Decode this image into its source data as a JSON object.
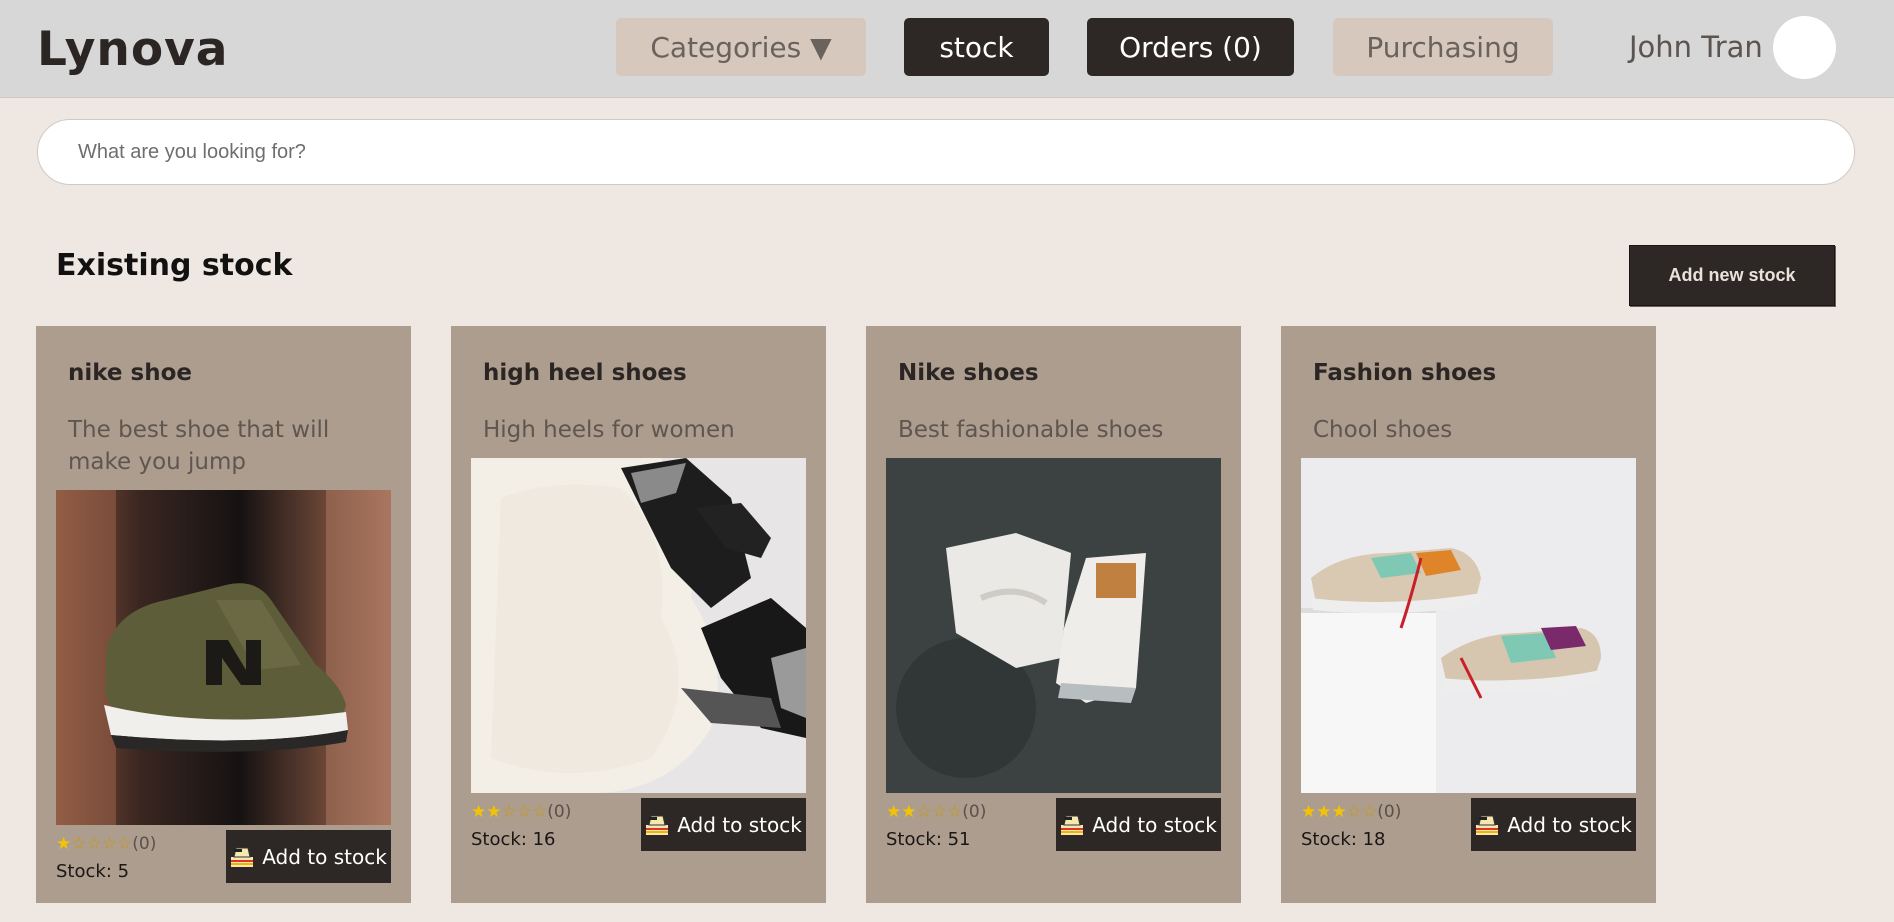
{
  "header": {
    "logo": "Lynova",
    "nav": {
      "categories": "Categories ▼",
      "stock": "stock",
      "orders": "Orders (0)",
      "purchasing": "Purchasing"
    },
    "user_name": "John Tran"
  },
  "search": {
    "placeholder": "What are you looking for?",
    "value": ""
  },
  "section": {
    "title": "Existing stock",
    "add_new_label": "Add new stock"
  },
  "products": [
    {
      "title": "nike shoe",
      "description": "The best shoe that will make you jump",
      "rating_stars": 1,
      "rating_max": 5,
      "rating_count": "(0)",
      "stock": "Stock: 5",
      "button": "Add to stock",
      "image": "green-sneaker-photo"
    },
    {
      "title": "high heel shoes",
      "description": "High heels for women",
      "rating_stars": 2,
      "rating_max": 5,
      "rating_count": "(0)",
      "stock": "Stock: 16",
      "button": "Add to stock",
      "image": "black-heels-on-fur-photo"
    },
    {
      "title": "Nike shoes",
      "description": "Best fashionable shoes",
      "rating_stars": 2,
      "rating_max": 5,
      "rating_count": "(0)",
      "stock": "Stock: 51",
      "button": "Add to stock",
      "image": "white-high-tops-photo"
    },
    {
      "title": "Fashion shoes",
      "description": "Chool shoes",
      "rating_stars": 3,
      "rating_max": 5,
      "rating_count": "(0)",
      "stock": "Stock: 18",
      "button": "Add to stock",
      "image": "colorful-sneakers-photo"
    }
  ],
  "colors": {
    "topbar": "#d7d7d7",
    "page_bg": "#efe8e2",
    "card_bg": "#ac9d8f",
    "dark_button": "#2d2825",
    "light_button": "#d6c8bd",
    "star": "#f5c400"
  }
}
